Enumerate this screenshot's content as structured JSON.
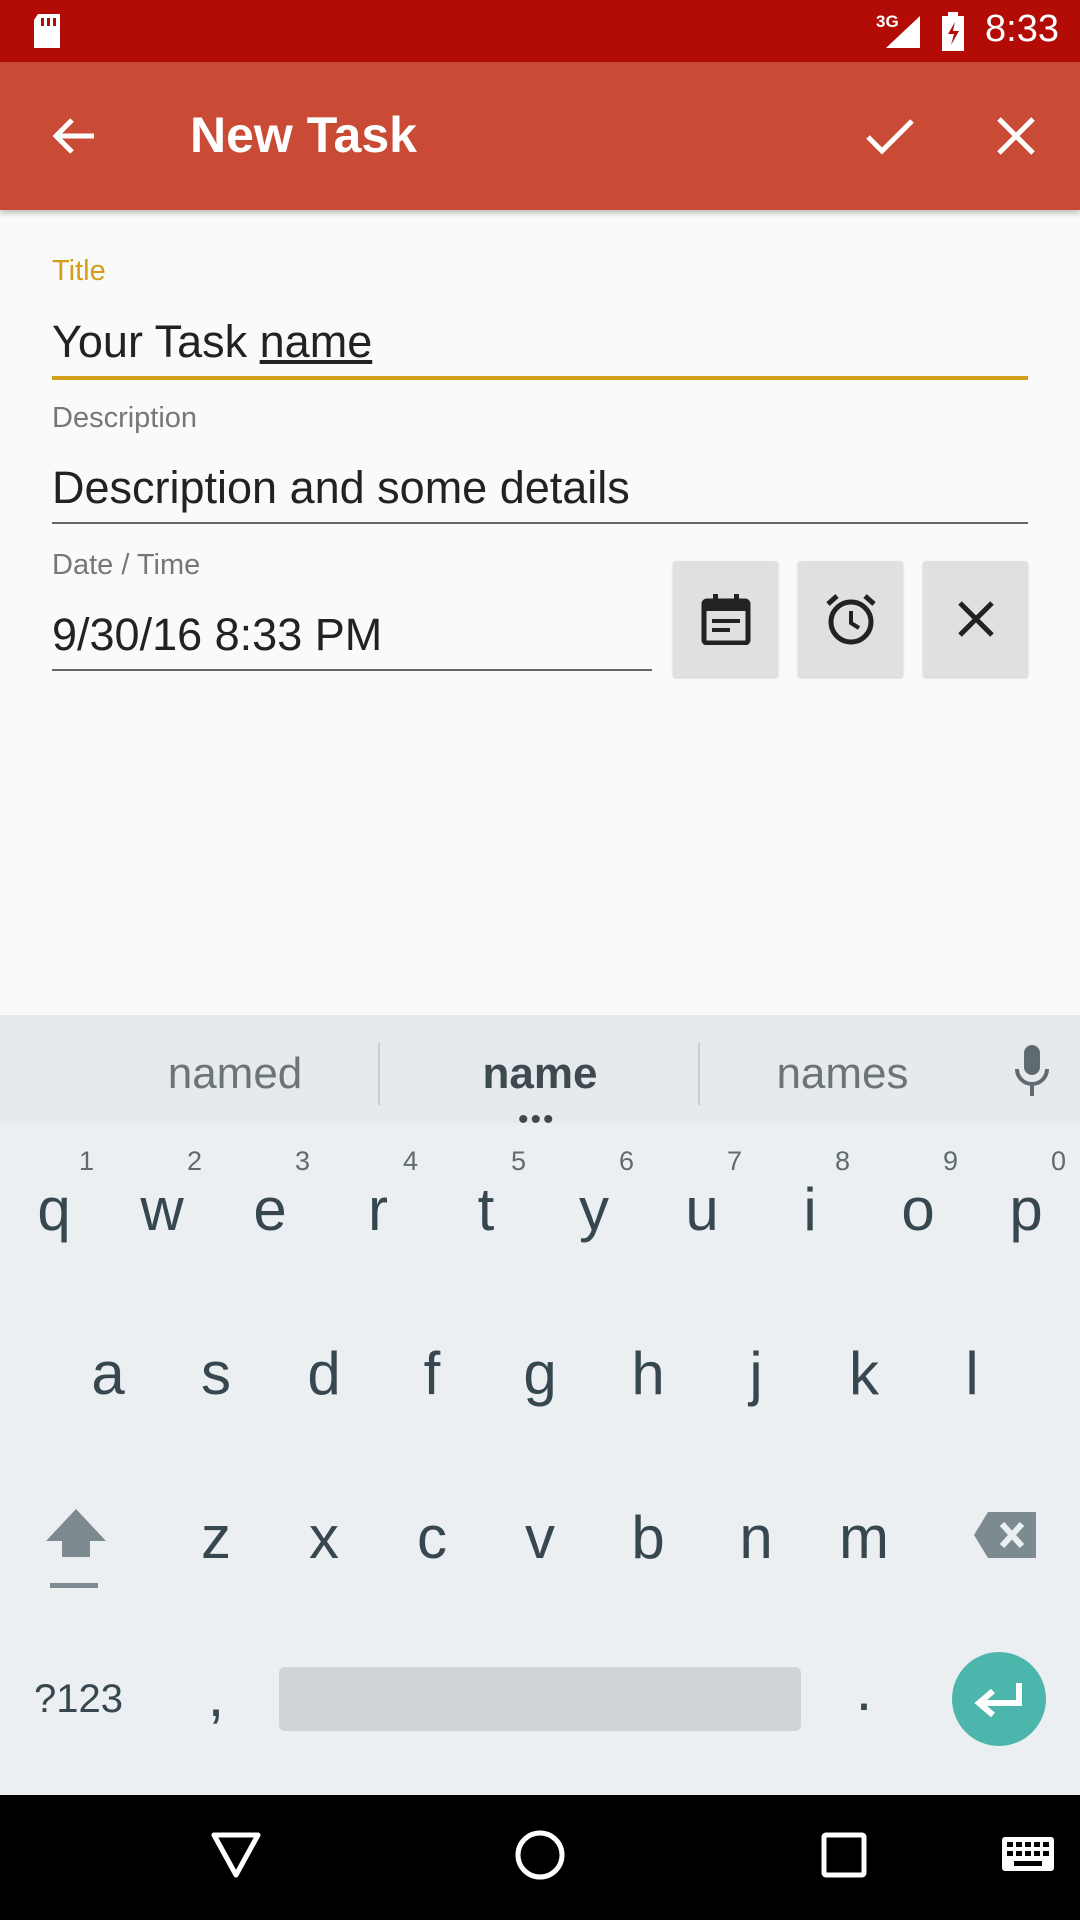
{
  "status_bar": {
    "network": "3G",
    "time": "8:33"
  },
  "app_bar": {
    "title": "New Task"
  },
  "form": {
    "title_label": "Title",
    "title_value_prefix": "Your Task ",
    "title_value_composing": "name",
    "description_label": "Description",
    "description_value": "Description and some details",
    "datetime_label": "Date / Time",
    "datetime_value": "9/30/16 8:33 PM"
  },
  "keyboard": {
    "suggestions": [
      "named",
      "name",
      "names"
    ],
    "row1": [
      {
        "key": "q",
        "hint": "1"
      },
      {
        "key": "w",
        "hint": "2"
      },
      {
        "key": "e",
        "hint": "3"
      },
      {
        "key": "r",
        "hint": "4"
      },
      {
        "key": "t",
        "hint": "5"
      },
      {
        "key": "y",
        "hint": "6"
      },
      {
        "key": "u",
        "hint": "7"
      },
      {
        "key": "i",
        "hint": "8"
      },
      {
        "key": "o",
        "hint": "9"
      },
      {
        "key": "p",
        "hint": "0"
      }
    ],
    "row2": [
      "a",
      "s",
      "d",
      "f",
      "g",
      "h",
      "j",
      "k",
      "l"
    ],
    "row3": [
      "z",
      "x",
      "c",
      "v",
      "b",
      "n",
      "m"
    ],
    "symbols_label": "?123",
    "comma": ",",
    "period": "."
  },
  "colors": {
    "status_bar": "#b30c06",
    "app_bar": "#c94a35",
    "accent": "#d59e1a",
    "enter_key": "#4db6ac"
  }
}
